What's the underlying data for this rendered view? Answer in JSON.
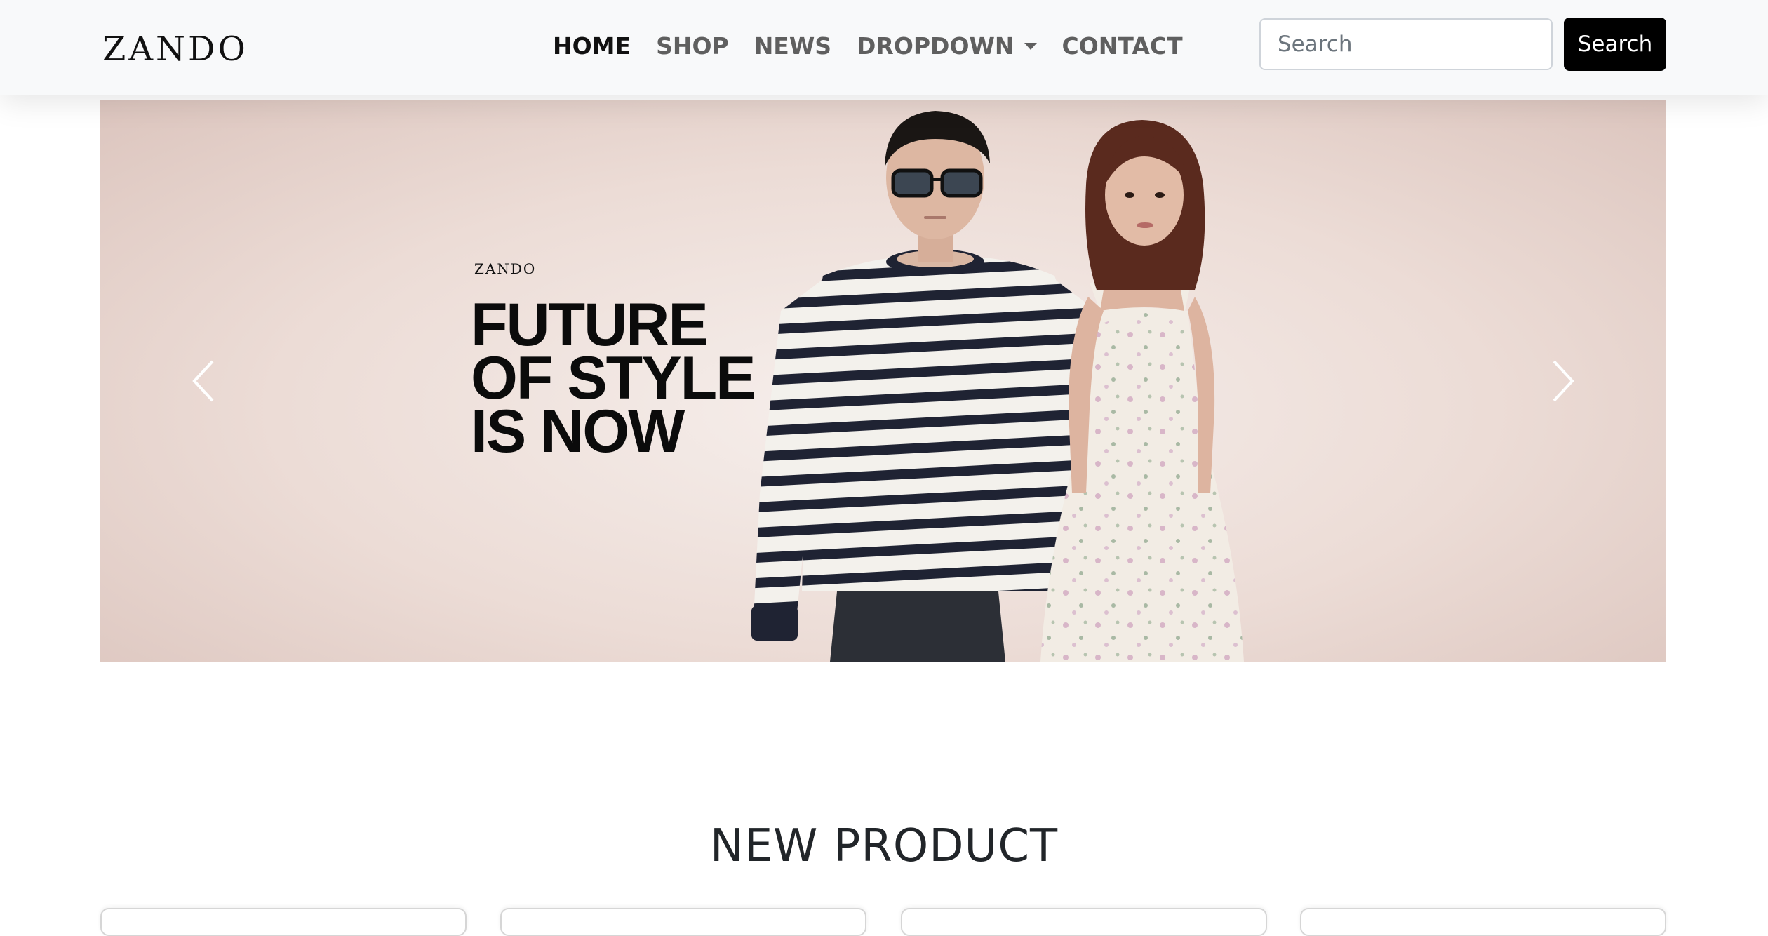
{
  "navbar": {
    "brand": "ZANDO",
    "links": [
      {
        "label": "HOME",
        "active": true
      },
      {
        "label": "SHOP",
        "active": false
      },
      {
        "label": "NEWS",
        "active": false
      },
      {
        "label": "DROPDOWN",
        "active": false,
        "has_dropdown": true
      },
      {
        "label": "CONTACT",
        "active": false
      }
    ],
    "search": {
      "placeholder": "Search",
      "button_label": "Search"
    }
  },
  "carousel": {
    "slide": {
      "brand": "ZANDO",
      "headline": [
        "FUTURE",
        "OF STYLE",
        "IS NOW"
      ]
    },
    "prev_icon": "chevron-left-icon",
    "next_icon": "chevron-right-icon"
  },
  "section": {
    "title": "NEW PRODUCT",
    "product_card_count": 4
  },
  "colors": {
    "navbar_bg": "#f8f9fa",
    "active_link": "#111111",
    "inactive_link": "#5f5f5f",
    "search_button_bg": "#000000",
    "search_button_text": "#ffffff"
  }
}
